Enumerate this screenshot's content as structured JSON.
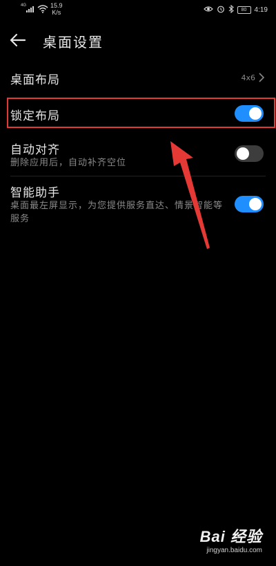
{
  "status_bar": {
    "network": "4G",
    "speed_value": "15.9",
    "speed_unit": "K/s",
    "battery": "80",
    "time": "4:19"
  },
  "header": {
    "back_icon": "arrow-left-icon",
    "title": "桌面设置"
  },
  "settings": {
    "layout": {
      "title": "桌面布局",
      "value": "4x6",
      "icon": "chevron-right-icon"
    },
    "lock_layout": {
      "title": "锁定布局",
      "enabled": true
    },
    "auto_align": {
      "title": "自动对齐",
      "subtitle": "删除应用后，自动补齐空位",
      "enabled": false
    },
    "assistant": {
      "title": "智能助手",
      "subtitle": "桌面最左屏显示，为您提供服务直达、情景智能等服务",
      "enabled": true
    }
  },
  "watermark": {
    "logo_text": "Bai 经验",
    "url": "jingyan.baidu.com"
  },
  "colors": {
    "accent": "#1f8fff",
    "highlight": "#e53935",
    "background": "#000000"
  }
}
